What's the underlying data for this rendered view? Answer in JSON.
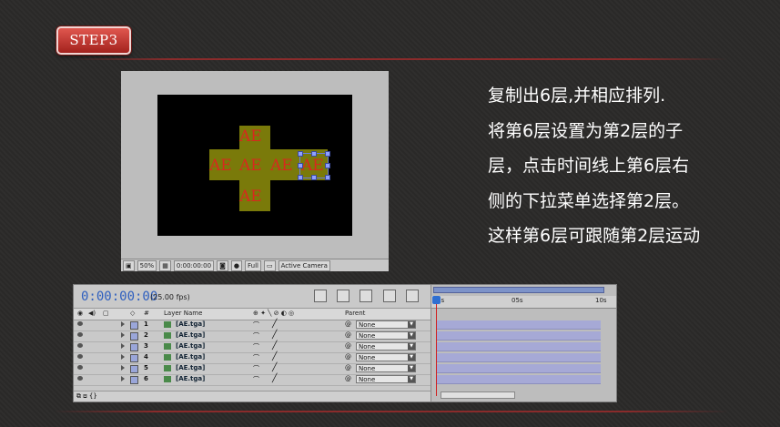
{
  "step_label": "STEP3",
  "composition": {
    "layer_text": "AE",
    "viewer_bar": {
      "zoom": "50%",
      "timecode": "0:00:00:00",
      "resolution": "Full",
      "camera": "Active Camera"
    }
  },
  "description": {
    "lines": [
      "复制出6层,并相应排列.",
      "将第6层设置为第2层的子",
      "层，点击时间线上第6层右",
      "侧的下拉菜单选择第2层。",
      "这样第6层可跟随第2层运动"
    ]
  },
  "timeline": {
    "timecode": "0:00:00:00",
    "fps": "(25.00 fps)",
    "headers": {
      "number": "#",
      "layer_name": "Layer Name",
      "parent": "Parent"
    },
    "ruler": {
      "start": "0s",
      "mid": "05s",
      "end": "10s"
    },
    "layers": [
      {
        "number": "1",
        "name": "[AE.tga]",
        "parent": "None"
      },
      {
        "number": "2",
        "name": "[AE.tga]",
        "parent": "None"
      },
      {
        "number": "3",
        "name": "[AE.tga]",
        "parent": "None"
      },
      {
        "number": "4",
        "name": "[AE.tga]",
        "parent": "None"
      },
      {
        "number": "5",
        "name": "[AE.tga]",
        "parent": "None"
      },
      {
        "number": "6",
        "name": "[AE.tga]",
        "parent": "None"
      }
    ]
  },
  "colors": {
    "background": "#2b2a29",
    "badge": "#b3312a",
    "accent_text": "#ffffff",
    "timecode": "#2e5fbf",
    "ae_text": "#d62a1d",
    "ae_block": "#7a7a0a"
  }
}
